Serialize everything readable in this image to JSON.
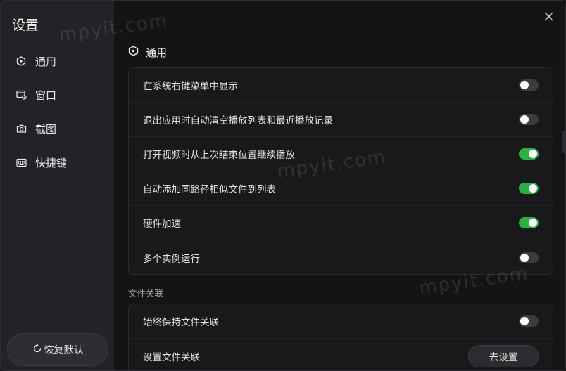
{
  "sidebar": {
    "title": "设置",
    "items": [
      {
        "label": "通用",
        "icon": "hexagon-icon"
      },
      {
        "label": "窗口",
        "icon": "window-icon"
      },
      {
        "label": "截图",
        "icon": "camera-icon"
      },
      {
        "label": "快捷键",
        "icon": "keyboard-icon"
      }
    ],
    "reset_label": "恢复默认"
  },
  "main": {
    "section_title": "通用",
    "general_rows": [
      {
        "label": "在系统右键菜单中显示",
        "enabled": false
      },
      {
        "label": "退出应用时自动清空播放列表和最近播放记录",
        "enabled": false
      },
      {
        "label": "打开视频时从上次结束位置继续播放",
        "enabled": true
      },
      {
        "label": "自动添加同路径相似文件到列表",
        "enabled": true
      },
      {
        "label": "硬件加速",
        "enabled": true
      },
      {
        "label": "多个实例运行",
        "enabled": false
      }
    ],
    "assoc_group_label": "文件关联",
    "assoc_rows": [
      {
        "label": "始终保持文件关联",
        "enabled": false
      },
      {
        "label": "设置文件关联",
        "button_label": "去设置"
      }
    ]
  },
  "watermark": "mpyit.com",
  "colors": {
    "toggle_on": "#27b33f",
    "toggle_off": "#3b3c40",
    "sidebar_bg": "#222326",
    "main_bg": "#141416"
  }
}
